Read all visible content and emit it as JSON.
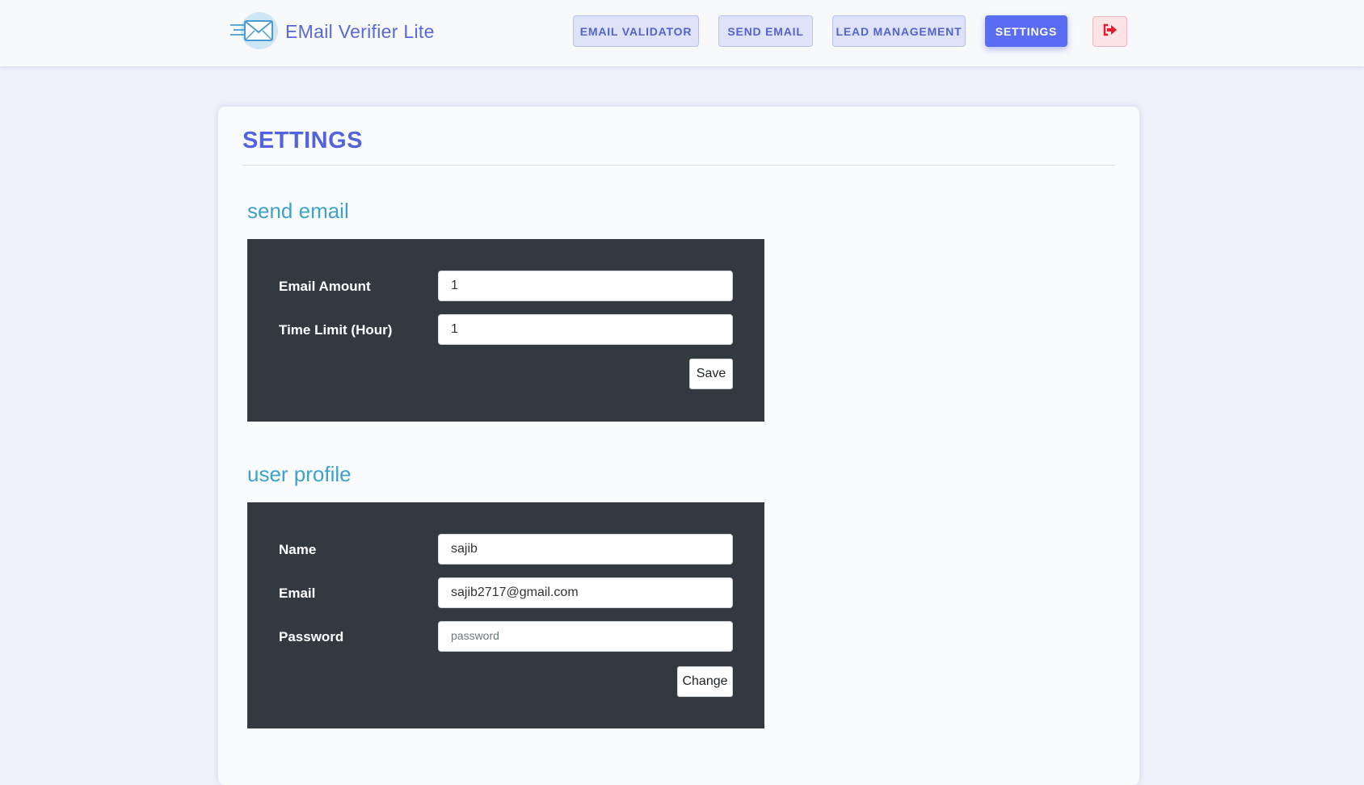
{
  "app": {
    "name": "EMail Verifier Lite",
    "logo_icon": "envelope-icon"
  },
  "nav": {
    "items": [
      {
        "label": "EMAIL VALIDATOR",
        "active": false
      },
      {
        "label": "SEND EMAIL",
        "active": false
      },
      {
        "label": "LEAD MANAGEMENT",
        "active": false
      },
      {
        "label": "SETTINGS",
        "active": true
      }
    ],
    "logout_icon": "sign-out-icon"
  },
  "page": {
    "title": "SETTINGS"
  },
  "send_email": {
    "title": "send email",
    "fields": [
      {
        "label": "Email Amount",
        "value": "1",
        "placeholder": ""
      },
      {
        "label": "Time Limit (Hour)",
        "value": "1",
        "placeholder": ""
      }
    ],
    "button_label": "Save"
  },
  "user_profile": {
    "title": "user profile",
    "fields": [
      {
        "label": "Name",
        "value": "sajib",
        "placeholder": ""
      },
      {
        "label": "Email",
        "value": "sajib2717@gmail.com",
        "placeholder": ""
      },
      {
        "label": "Password",
        "value": "",
        "placeholder": "password"
      }
    ],
    "button_label": "Change"
  },
  "colors": {
    "accent": "#5a6cf2",
    "section_title": "#3ea2c8",
    "panel_bg": "#343940",
    "page_bg": "#eef0fb",
    "logout": "#e8192c"
  }
}
